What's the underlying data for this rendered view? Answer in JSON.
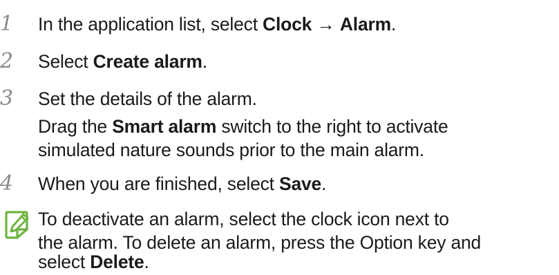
{
  "steps": [
    {
      "number": "1",
      "lines": [
        {
          "pre": "In the application list, select ",
          "b1": "Clock",
          "mid": " → ",
          "b2": "Alarm",
          "post": "."
        }
      ]
    },
    {
      "number": "2",
      "lines": [
        {
          "pre": "Select ",
          "b1": "Create alarm",
          "post": "."
        }
      ]
    },
    {
      "number": "3",
      "lines": [
        {
          "text": "Set the details of the alarm."
        },
        {
          "pre": "Drag the ",
          "b1": "Smart alarm",
          "post": " switch to the right to activate"
        },
        {
          "text": "simulated nature sounds prior to the main alarm."
        }
      ]
    },
    {
      "number": "4",
      "lines": [
        {
          "pre": "When you are finished, select ",
          "b1": "Save",
          "post": "."
        }
      ]
    }
  ],
  "note": {
    "icon": "note-pencil-icon",
    "icon_color": "#6cb33f",
    "lines": [
      {
        "text": "To deactivate an alarm, select the clock icon next to"
      },
      {
        "text": "the alarm. To delete an alarm, press the Option key and"
      },
      {
        "pre": "select ",
        "b1": "Delete",
        "post": "."
      }
    ]
  }
}
